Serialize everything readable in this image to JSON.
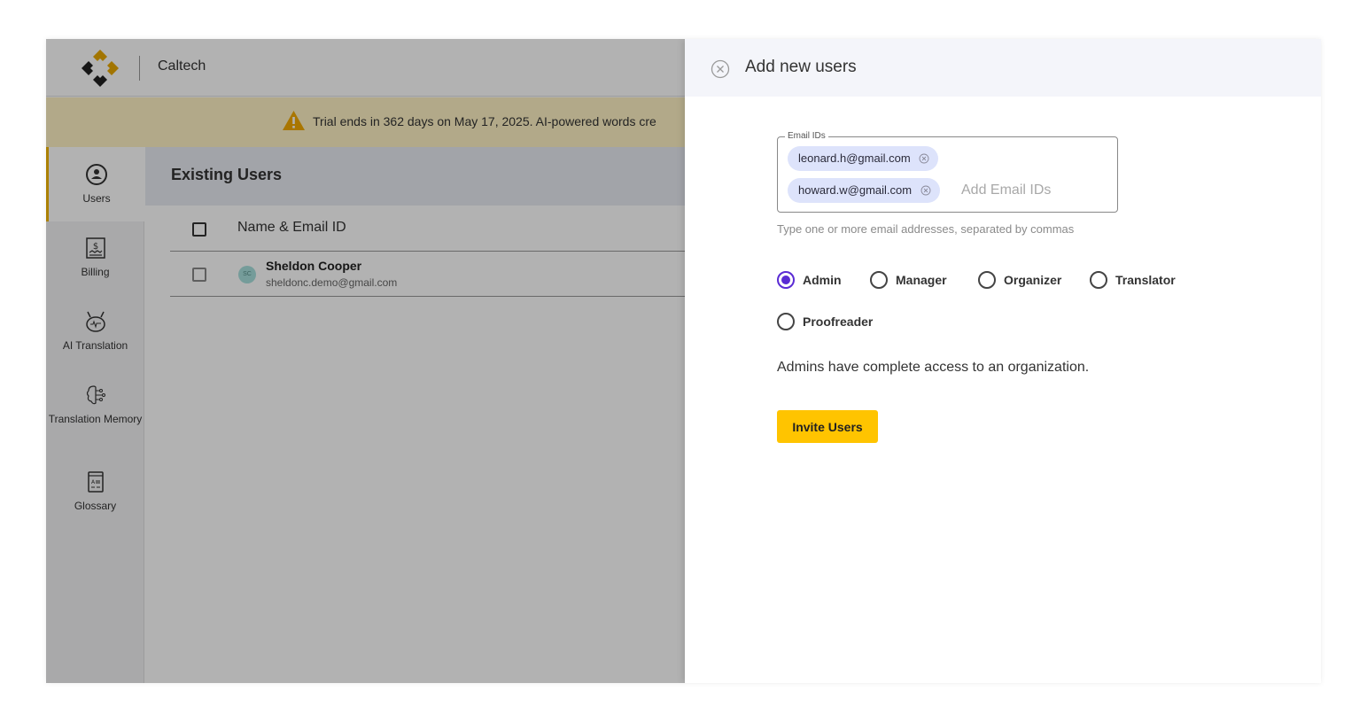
{
  "topbar": {
    "org_name": "Caltech"
  },
  "banner": {
    "text": "Trial ends in 362 days on May 17, 2025. AI-powered words cre"
  },
  "sidenav": {
    "items": [
      {
        "label": "Users",
        "icon": "user-circle-icon",
        "active": true
      },
      {
        "label": "Billing",
        "icon": "billing-receipt-icon",
        "active": false
      },
      {
        "label": "AI Translation",
        "icon": "ai-robot-icon",
        "active": false
      },
      {
        "label": "Translation Memory",
        "icon": "brain-icon",
        "active": false
      },
      {
        "label": "Glossary",
        "icon": "glossary-book-icon",
        "active": false
      }
    ]
  },
  "users_page": {
    "title": "Existing Users",
    "column_name": "Name & Email ID",
    "rows": [
      {
        "initials": "SC",
        "name": "Sheldon Cooper",
        "email": "sheldonc.demo@gmail.com"
      }
    ]
  },
  "drawer": {
    "title": "Add new users",
    "email_label": "Email IDs",
    "chips": [
      "leonard.h@gmail.com",
      "howard.w@gmail.com"
    ],
    "email_placeholder": "Add Email IDs",
    "helper": "Type one or more email addresses, separated by commas",
    "roles": [
      {
        "label": "Admin",
        "checked": true
      },
      {
        "label": "Manager",
        "checked": false
      },
      {
        "label": "Organizer",
        "checked": false
      },
      {
        "label": "Translator",
        "checked": false
      },
      {
        "label": "Proofreader",
        "checked": false
      }
    ],
    "role_description": "Admins have complete access to an organization.",
    "invite_label": "Invite Users"
  },
  "colors": {
    "accent": "#ffc400",
    "radio_selected": "#5a2bd4",
    "chip_bg": "#dde3fb"
  }
}
